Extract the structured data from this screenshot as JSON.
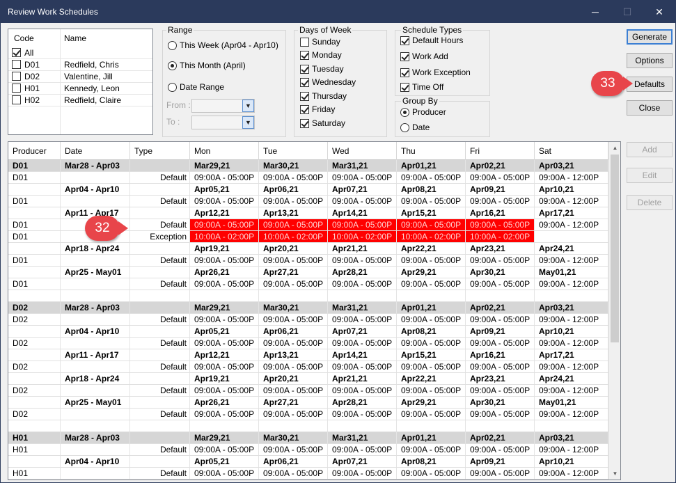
{
  "window": {
    "title": "Review Work Schedules",
    "minimize": "─",
    "maximize": "☐",
    "close": "✕"
  },
  "codes": {
    "headers": [
      "Code",
      "Name"
    ],
    "items": [
      {
        "code": "All",
        "name": "",
        "checked": true
      },
      {
        "code": "D01",
        "name": "Redfield, Chris",
        "checked": false
      },
      {
        "code": "D02",
        "name": "Valentine, Jill",
        "checked": false
      },
      {
        "code": "H01",
        "name": "Kennedy, Leon",
        "checked": false
      },
      {
        "code": "H02",
        "name": "Redfield, Claire",
        "checked": false
      }
    ]
  },
  "range": {
    "title": "Range",
    "options": [
      {
        "label": "This Week (Apr04 - Apr10)",
        "selected": false
      },
      {
        "label": "This Month (April)",
        "selected": true
      },
      {
        "label": "Date Range",
        "selected": false
      }
    ],
    "from_label": "From :",
    "to_label": "To :"
  },
  "days": {
    "title": "Days of Week",
    "items": [
      {
        "label": "Sunday",
        "checked": false
      },
      {
        "label": "Monday",
        "checked": true
      },
      {
        "label": "Tuesday",
        "checked": true
      },
      {
        "label": "Wednesday",
        "checked": true
      },
      {
        "label": "Thursday",
        "checked": true
      },
      {
        "label": "Friday",
        "checked": true
      },
      {
        "label": "Saturday",
        "checked": true
      }
    ]
  },
  "schedule_types": {
    "title": "Schedule Types",
    "items": [
      {
        "label": "Default Hours",
        "checked": true
      },
      {
        "label": "Work Add",
        "checked": true
      },
      {
        "label": "Work Exception",
        "checked": true
      },
      {
        "label": "Time Off",
        "checked": true
      }
    ]
  },
  "group_by": {
    "title": "Group By",
    "options": [
      {
        "label": "Producer",
        "selected": true
      },
      {
        "label": "Date",
        "selected": false
      }
    ]
  },
  "buttons": {
    "generate": "Generate",
    "options": "Options",
    "defaults": "Defaults",
    "close": "Close",
    "add": "Add",
    "edit": "Edit",
    "delete": "Delete"
  },
  "callouts": {
    "c32": "32",
    "c33": "33"
  },
  "colors": {
    "exception_highlight": "#ff0000",
    "callout": "#e8454a",
    "group_header": "#d6d6d6"
  },
  "grid": {
    "headers": [
      "Producer",
      "Date",
      "Type",
      "Mon",
      "Tue",
      "Wed",
      "Thu",
      "Fri",
      "Sat"
    ],
    "rows": [
      {
        "kind": "group",
        "cells": [
          "D01",
          "Mar28 - Apr03",
          "",
          "Mar29,21",
          "Mar30,21",
          "Mar31,21",
          "Apr01,21",
          "Apr02,21",
          "Apr03,21"
        ]
      },
      {
        "kind": "data",
        "cells": [
          "D01",
          "",
          "Default",
          "09:00A - 05:00P",
          "09:00A - 05:00P",
          "09:00A - 05:00P",
          "09:00A - 05:00P",
          "09:00A - 05:00P",
          "09:00A - 12:00P"
        ]
      },
      {
        "kind": "week",
        "cells": [
          "",
          "Apr04 - Apr10",
          "",
          "Apr05,21",
          "Apr06,21",
          "Apr07,21",
          "Apr08,21",
          "Apr09,21",
          "Apr10,21"
        ]
      },
      {
        "kind": "data",
        "cells": [
          "D01",
          "",
          "Default",
          "09:00A - 05:00P",
          "09:00A - 05:00P",
          "09:00A - 05:00P",
          "09:00A - 05:00P",
          "09:00A - 05:00P",
          "09:00A - 12:00P"
        ]
      },
      {
        "kind": "week",
        "cells": [
          "",
          "Apr11 - Apr17",
          "",
          "Apr12,21",
          "Apr13,21",
          "Apr14,21",
          "Apr15,21",
          "Apr16,21",
          "Apr17,21"
        ]
      },
      {
        "kind": "data",
        "red": [
          3,
          4,
          5,
          6,
          7
        ],
        "cells": [
          "D01",
          "",
          "Default",
          "09:00A - 05:00P",
          "09:00A - 05:00P",
          "09:00A - 05:00P",
          "09:00A - 05:00P",
          "09:00A - 05:00P",
          "09:00A - 12:00P"
        ]
      },
      {
        "kind": "data",
        "red": [
          3,
          4,
          5,
          6,
          7
        ],
        "cells": [
          "D01",
          "",
          "Exception",
          "10:00A - 02:00P",
          "10:00A - 02:00P",
          "10:00A - 02:00P",
          "10:00A - 02:00P",
          "10:00A - 02:00P",
          ""
        ]
      },
      {
        "kind": "week",
        "cells": [
          "",
          "Apr18 - Apr24",
          "",
          "Apr19,21",
          "Apr20,21",
          "Apr21,21",
          "Apr22,21",
          "Apr23,21",
          "Apr24,21"
        ]
      },
      {
        "kind": "data",
        "cells": [
          "D01",
          "",
          "Default",
          "09:00A - 05:00P",
          "09:00A - 05:00P",
          "09:00A - 05:00P",
          "09:00A - 05:00P",
          "09:00A - 05:00P",
          "09:00A - 12:00P"
        ]
      },
      {
        "kind": "week",
        "cells": [
          "",
          "Apr25 - May01",
          "",
          "Apr26,21",
          "Apr27,21",
          "Apr28,21",
          "Apr29,21",
          "Apr30,21",
          "May01,21"
        ]
      },
      {
        "kind": "data",
        "cells": [
          "D01",
          "",
          "Default",
          "09:00A - 05:00P",
          "09:00A - 05:00P",
          "09:00A - 05:00P",
          "09:00A - 05:00P",
          "09:00A - 05:00P",
          "09:00A - 12:00P"
        ]
      },
      {
        "kind": "blank",
        "cells": [
          "",
          "",
          "",
          "",
          "",
          "",
          "",
          "",
          ""
        ]
      },
      {
        "kind": "group",
        "cells": [
          "D02",
          "Mar28 - Apr03",
          "",
          "Mar29,21",
          "Mar30,21",
          "Mar31,21",
          "Apr01,21",
          "Apr02,21",
          "Apr03,21"
        ]
      },
      {
        "kind": "data",
        "cells": [
          "D02",
          "",
          "Default",
          "09:00A - 05:00P",
          "09:00A - 05:00P",
          "09:00A - 05:00P",
          "09:00A - 05:00P",
          "09:00A - 05:00P",
          "09:00A - 12:00P"
        ]
      },
      {
        "kind": "week",
        "cells": [
          "",
          "Apr04 - Apr10",
          "",
          "Apr05,21",
          "Apr06,21",
          "Apr07,21",
          "Apr08,21",
          "Apr09,21",
          "Apr10,21"
        ]
      },
      {
        "kind": "data",
        "cells": [
          "D02",
          "",
          "Default",
          "09:00A - 05:00P",
          "09:00A - 05:00P",
          "09:00A - 05:00P",
          "09:00A - 05:00P",
          "09:00A - 05:00P",
          "09:00A - 12:00P"
        ]
      },
      {
        "kind": "week",
        "cells": [
          "",
          "Apr11 - Apr17",
          "",
          "Apr12,21",
          "Apr13,21",
          "Apr14,21",
          "Apr15,21",
          "Apr16,21",
          "Apr17,21"
        ]
      },
      {
        "kind": "data",
        "cells": [
          "D02",
          "",
          "Default",
          "09:00A - 05:00P",
          "09:00A - 05:00P",
          "09:00A - 05:00P",
          "09:00A - 05:00P",
          "09:00A - 05:00P",
          "09:00A - 12:00P"
        ]
      },
      {
        "kind": "week",
        "cells": [
          "",
          "Apr18 - Apr24",
          "",
          "Apr19,21",
          "Apr20,21",
          "Apr21,21",
          "Apr22,21",
          "Apr23,21",
          "Apr24,21"
        ]
      },
      {
        "kind": "data",
        "cells": [
          "D02",
          "",
          "Default",
          "09:00A - 05:00P",
          "09:00A - 05:00P",
          "09:00A - 05:00P",
          "09:00A - 05:00P",
          "09:00A - 05:00P",
          "09:00A - 12:00P"
        ]
      },
      {
        "kind": "week",
        "cells": [
          "",
          "Apr25 - May01",
          "",
          "Apr26,21",
          "Apr27,21",
          "Apr28,21",
          "Apr29,21",
          "Apr30,21",
          "May01,21"
        ]
      },
      {
        "kind": "data",
        "cells": [
          "D02",
          "",
          "Default",
          "09:00A - 05:00P",
          "09:00A - 05:00P",
          "09:00A - 05:00P",
          "09:00A - 05:00P",
          "09:00A - 05:00P",
          "09:00A - 12:00P"
        ]
      },
      {
        "kind": "blank",
        "cells": [
          "",
          "",
          "",
          "",
          "",
          "",
          "",
          "",
          ""
        ]
      },
      {
        "kind": "group",
        "cells": [
          "H01",
          "Mar28 - Apr03",
          "",
          "Mar29,21",
          "Mar30,21",
          "Mar31,21",
          "Apr01,21",
          "Apr02,21",
          "Apr03,21"
        ]
      },
      {
        "kind": "data",
        "cells": [
          "H01",
          "",
          "Default",
          "09:00A - 05:00P",
          "09:00A - 05:00P",
          "09:00A - 05:00P",
          "09:00A - 05:00P",
          "09:00A - 05:00P",
          "09:00A - 12:00P"
        ]
      },
      {
        "kind": "week",
        "cells": [
          "",
          "Apr04 - Apr10",
          "",
          "Apr05,21",
          "Apr06,21",
          "Apr07,21",
          "Apr08,21",
          "Apr09,21",
          "Apr10,21"
        ]
      },
      {
        "kind": "data",
        "cells": [
          "H01",
          "",
          "Default",
          "09:00A - 05:00P",
          "09:00A - 05:00P",
          "09:00A - 05:00P",
          "09:00A - 05:00P",
          "09:00A - 05:00P",
          "09:00A - 12:00P"
        ]
      }
    ]
  }
}
